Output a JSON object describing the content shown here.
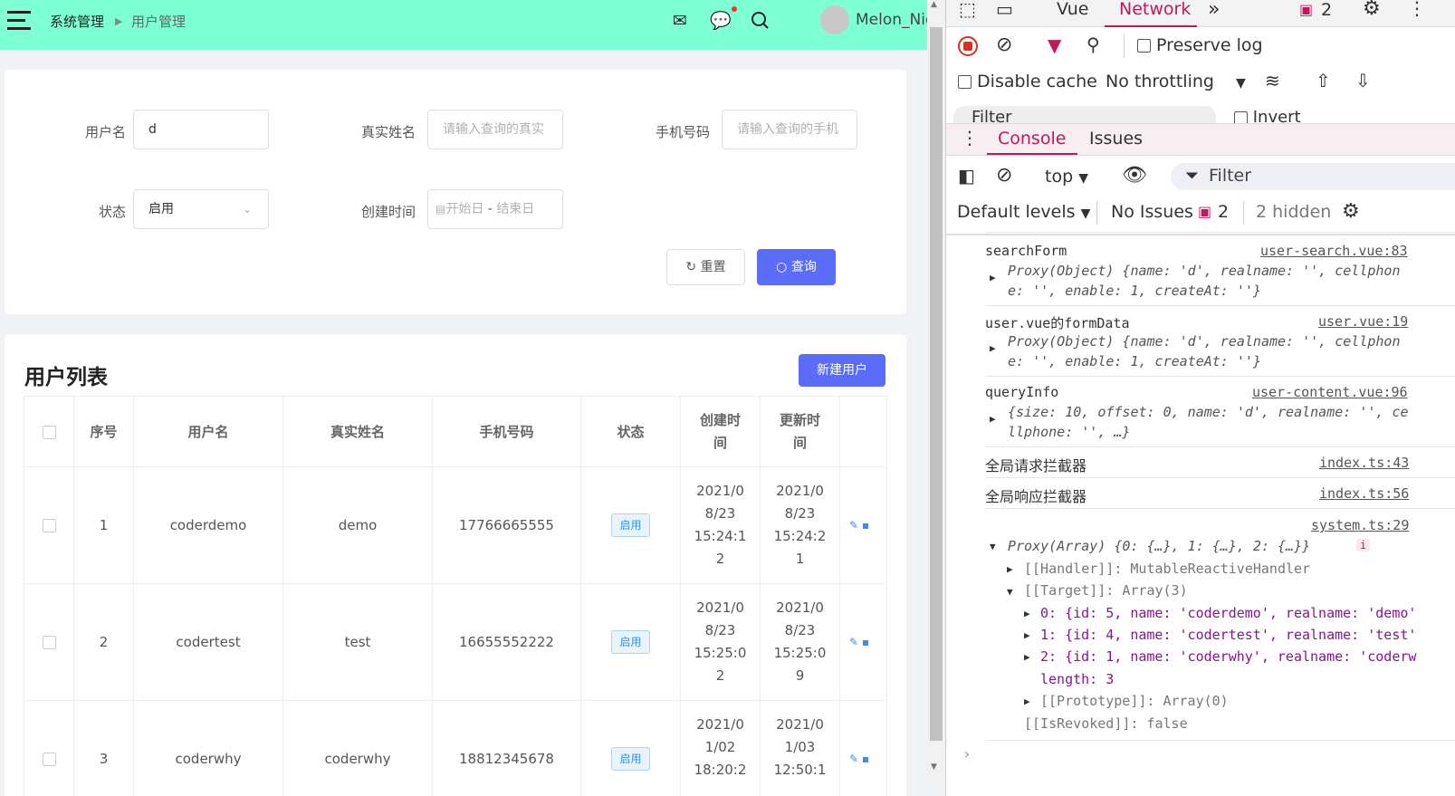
{
  "header": {
    "breadcrumb": [
      "系统管理",
      "用户管理"
    ],
    "username": "Melon_Nie"
  },
  "search": {
    "labels": {
      "name": "用户名",
      "realname": "真实姓名",
      "cellphone": "手机号码",
      "status": "状态",
      "created": "创建时间"
    },
    "name_value": "d",
    "realname_placeholder": "请输入查询的真实",
    "cellphone_placeholder": "请输入查询的手机",
    "status_value": "启用",
    "date_start": "开始日",
    "date_sep": "-",
    "date_end": "结束日",
    "reset_label": "重置",
    "query_label": "查询"
  },
  "list": {
    "title": "用户列表",
    "new_button": "新建用户",
    "columns": [
      "序号",
      "用户名",
      "真实姓名",
      "手机号码",
      "状态",
      "创建时\n间",
      "更新时\n间"
    ],
    "rows": [
      {
        "index": "1",
        "name": "coderdemo",
        "realname": "demo",
        "cellphone": "17766665555",
        "status": "启用",
        "created": "2021/0\n8/23\n15:24:1\n2",
        "updated": "2021/0\n8/23\n15:24:2\n1"
      },
      {
        "index": "2",
        "name": "codertest",
        "realname": "test",
        "cellphone": "16655552222",
        "status": "启用",
        "created": "2021/0\n8/23\n15:25:0\n2",
        "updated": "2021/0\n8/23\n15:25:0\n9"
      },
      {
        "index": "3",
        "name": "coderwhy",
        "realname": "coderwhy",
        "cellphone": "18812345678",
        "status": "启用",
        "created": "2021/0\n1/02\n18:20:2",
        "updated": "2021/0\n1/03\n12:50:1"
      }
    ]
  },
  "devtools": {
    "tabs": [
      "Vue",
      "Network"
    ],
    "issues_count": "2",
    "preserve_log": "Preserve log",
    "disable_cache": "Disable cache",
    "throttling": "No throttling",
    "filter_partial": "Filter",
    "invert_partial": "Invert",
    "drawer_tabs": [
      "Console",
      "Issues"
    ],
    "context": "top",
    "filter_placeholder": "Filter",
    "levels": "Default levels",
    "no_issues": "No Issues",
    "issues_badge": "2",
    "hidden": "2 hidden",
    "messages": [
      {
        "label": "searchForm",
        "source": "user-search.vue:83",
        "line1": "Proxy(Object)  {name: 'd', realname: '', cellphon",
        "line2": "e: '', enable: 1, createAt: ''}"
      },
      {
        "label": "user.vue的formData",
        "source": "user.vue:19",
        "line1": "Proxy(Object)  {name: 'd', realname: '', cellphon",
        "line2": "e: '', enable: 1, createAt: ''}"
      },
      {
        "label": "queryInfo",
        "source": "user-content.vue:96",
        "line1": "{size: 10, offset: 0, name: 'd', realname: '', ce",
        "line2": "llphone: '',  …}"
      },
      {
        "label": "全局请求拦截器",
        "source": "index.ts:43"
      },
      {
        "label": "全局响应拦截器",
        "source": "index.ts:56"
      }
    ],
    "array_source": "system.ts:29",
    "array_summary": "Proxy(Array)  {0: {…}, 1: {…}, 2: {…}}",
    "handler": "[[Handler]]: MutableReactiveHandler",
    "target": "[[Target]]: Array(3)",
    "items": [
      "0: {id: 5, name: 'coderdemo', realname: 'demo'",
      "1: {id: 4, name: 'codertest', realname: 'test'",
      "2: {id: 1, name: 'coderwhy', realname: 'coderw"
    ],
    "length_line": "length: 3",
    "prototype": "[[Prototype]]: Array(0)",
    "revoked": "[[IsRevoked]]: false"
  }
}
